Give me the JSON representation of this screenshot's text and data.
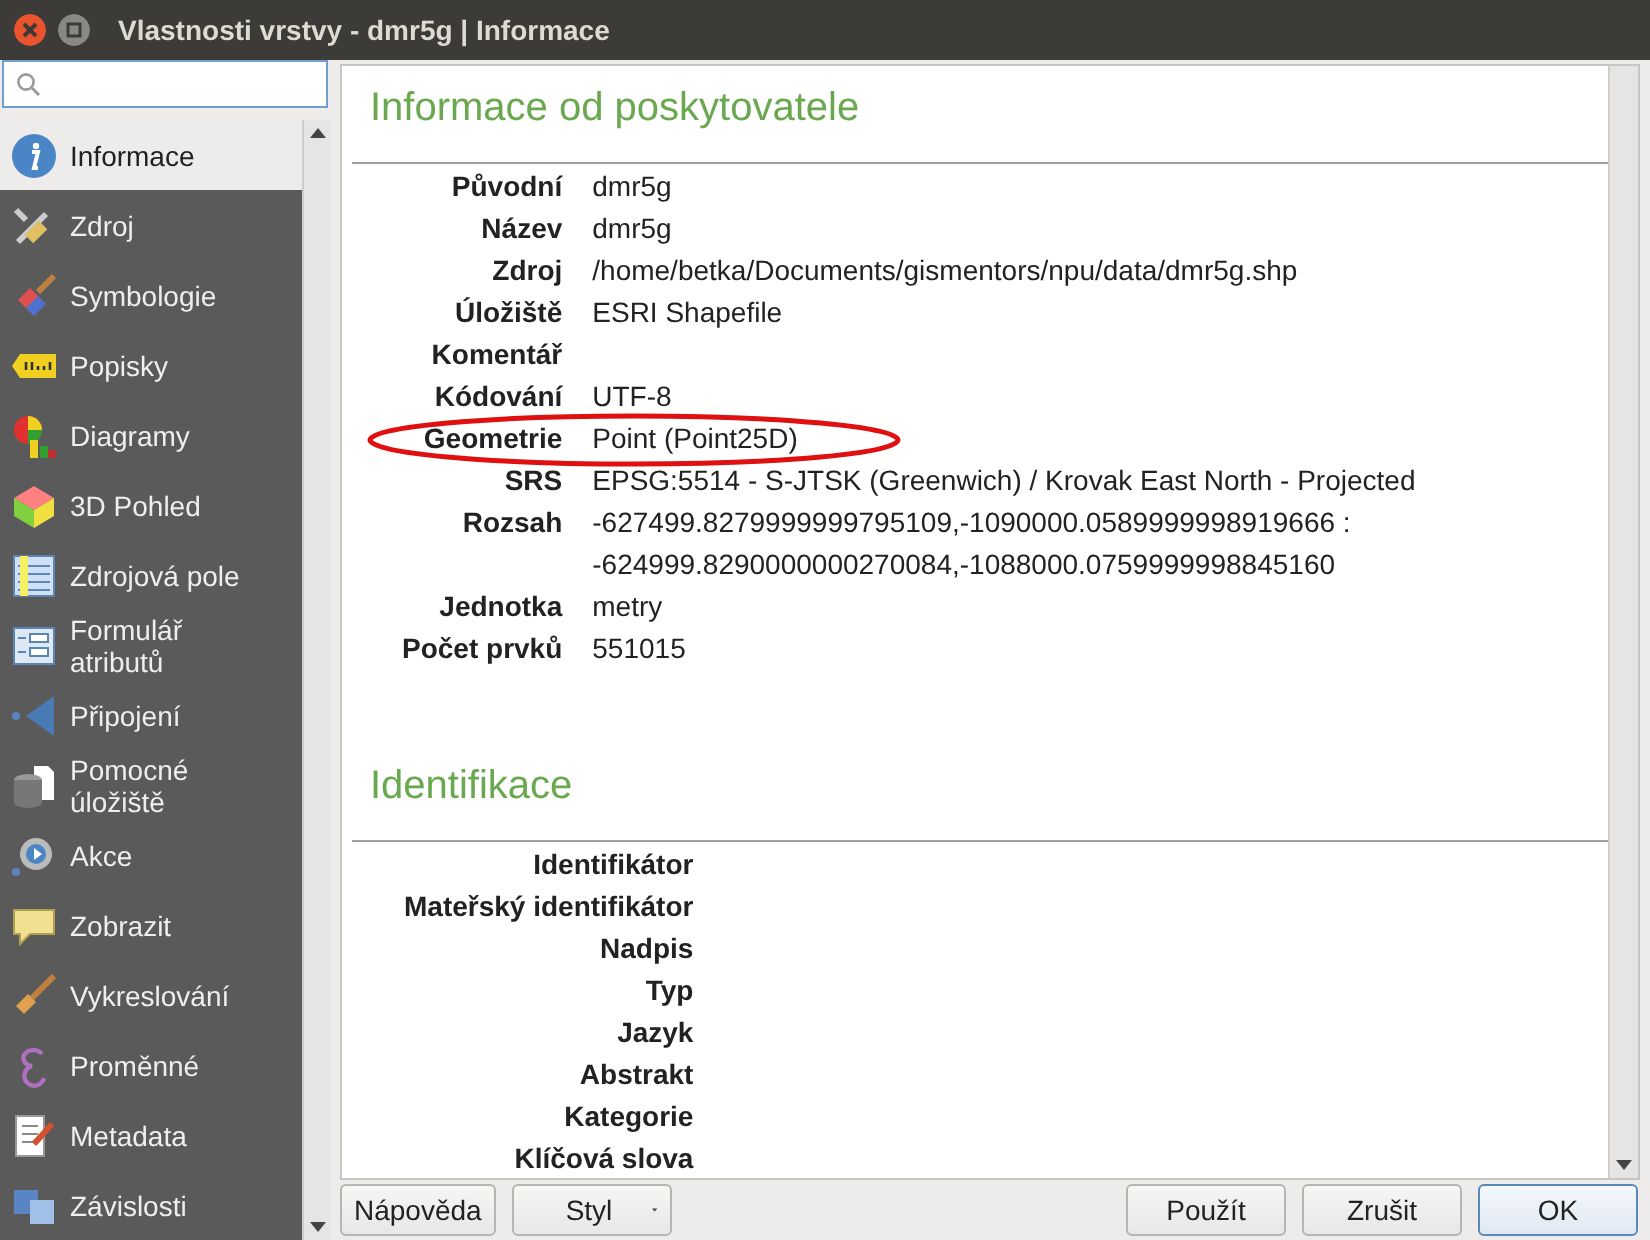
{
  "window": {
    "title": "Vlastnosti vrstvy - dmr5g | Informace"
  },
  "sidebar": {
    "items": [
      {
        "label": "Informace",
        "selected": true
      },
      {
        "label": "Zdroj",
        "selected": false
      },
      {
        "label": "Symbologie",
        "selected": false
      },
      {
        "label": "Popisky",
        "selected": false
      },
      {
        "label": "Diagramy",
        "selected": false
      },
      {
        "label": "3D Pohled",
        "selected": false
      },
      {
        "label": "Zdrojová pole",
        "selected": false
      },
      {
        "label": "Formulář atributů",
        "selected": false
      },
      {
        "label": "Připojení",
        "selected": false
      },
      {
        "label": "Pomocné úložiště",
        "selected": false
      },
      {
        "label": "Akce",
        "selected": false
      },
      {
        "label": "Zobrazit",
        "selected": false
      },
      {
        "label": "Vykreslování",
        "selected": false
      },
      {
        "label": "Proměnné",
        "selected": false
      },
      {
        "label": "Metadata",
        "selected": false
      },
      {
        "label": "Závislosti",
        "selected": false
      }
    ]
  },
  "sections": [
    {
      "title": "Informace od poskytovatele",
      "rows": [
        {
          "label": "Původní",
          "value": "dmr5g",
          "highlighted": false
        },
        {
          "label": "Název",
          "value": "dmr5g",
          "highlighted": false
        },
        {
          "label": "Zdroj",
          "value": "/home/betka/Documents/gismentors/npu/data/dmr5g.shp",
          "highlighted": false
        },
        {
          "label": "Úložiště",
          "value": "ESRI Shapefile",
          "highlighted": false
        },
        {
          "label": "Komentář",
          "highlighted": false
        },
        {
          "label": "Kódování",
          "value": "UTF-8",
          "highlighted": false
        },
        {
          "label": "Geometrie",
          "value": "Point (Point25D)",
          "highlighted": true
        },
        {
          "label": "SRS",
          "value": "EPSG:5514 - S-JTSK (Greenwich) / Krovak East North - Projected",
          "highlighted": false
        },
        {
          "label": "Rozsah",
          "value": "-627499.8279999999795109,-1090000.0589999998919666 : -624999.8290000000270084,-1088000.0759999998845160",
          "highlighted": false
        },
        {
          "label": "Jednotka",
          "value": "metry",
          "highlighted": false
        },
        {
          "label": "Počet prvků",
          "value": "551015",
          "highlighted": false
        }
      ]
    },
    {
      "title": "Identifikace",
      "rows": [
        {
          "label": "Identifikátor",
          "highlighted": false
        },
        {
          "label": "Mateřský identifikátor",
          "highlighted": false
        },
        {
          "label": "Nadpis",
          "highlighted": false
        },
        {
          "label": "Typ",
          "highlighted": false
        },
        {
          "label": "Jazyk",
          "highlighted": false
        },
        {
          "label": "Abstrakt",
          "highlighted": false
        },
        {
          "label": "Kategorie",
          "highlighted": false
        },
        {
          "label": "Klíčová slova",
          "highlighted": false
        }
      ]
    }
  ],
  "buttons_left": [
    {
      "label": "Nápověda",
      "kind": "plain"
    },
    {
      "label": "Styl",
      "kind": "menu"
    }
  ],
  "buttons_right": [
    {
      "label": "Použít",
      "default": false
    },
    {
      "label": "Zrušit",
      "default": false
    },
    {
      "label": "OK",
      "default": true
    }
  ]
}
